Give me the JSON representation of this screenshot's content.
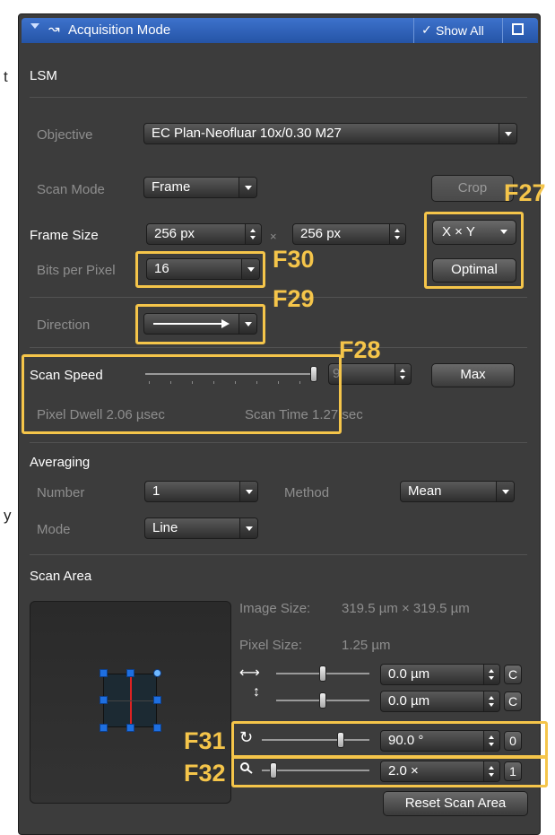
{
  "left_clip": {
    "chars": [
      "t",
      "y"
    ]
  },
  "header": {
    "title": "Acquisition Mode",
    "show_all": "Show All"
  },
  "section_lsm": "LSM",
  "objective": {
    "label": "Objective",
    "value": "EC Plan-Neofluar 10x/0.30 M27"
  },
  "scan_mode": {
    "label": "Scan Mode",
    "value": "Frame",
    "crop": "Crop"
  },
  "frame_size": {
    "label": "Frame Size",
    "x": "256 px",
    "times": "×",
    "y": "256 px",
    "xy": "X × Y",
    "optimal": "Optimal"
  },
  "bits": {
    "label": "Bits per Pixel",
    "value": "16"
  },
  "direction": {
    "label": "Direction"
  },
  "scan_speed": {
    "label": "Scan Speed",
    "value": "9",
    "max": "Max",
    "level": 0.97,
    "pixel_dwell": "Pixel Dwell 2.06 µsec",
    "scan_time": "Scan Time 1.27 sec"
  },
  "averaging": {
    "title": "Averaging",
    "number_label": "Number",
    "number": "1",
    "method_label": "Method",
    "method": "Mean",
    "mode_label": "Mode",
    "mode": "Line"
  },
  "scan_area": {
    "title": "Scan Area",
    "image_size_label": "Image Size:",
    "image_size": "319.5 µm × 319.5 µm",
    "pixel_size_label": "Pixel Size:",
    "pixel_size": "1.25 µm",
    "offset_x": {
      "value": "0.0 µm",
      "btn": "C",
      "level": 0.5
    },
    "offset_y": {
      "value": "0.0 µm",
      "btn": "C",
      "level": 0.5
    },
    "rotation": {
      "value": "90.0 °",
      "btn": "0",
      "level": 0.75
    },
    "zoom": {
      "value": "2.0 ×",
      "btn": "1",
      "level": 0.08
    },
    "reset": "Reset Scan Area"
  },
  "callouts": {
    "f27": "F27",
    "f28": "F28",
    "f29": "F29",
    "f30": "F30",
    "f31": "F31",
    "f32": "F32"
  },
  "colors": {
    "accent": "#f5c54a",
    "header_blue": "#2f63bd",
    "panel": "#3c3c3c"
  }
}
